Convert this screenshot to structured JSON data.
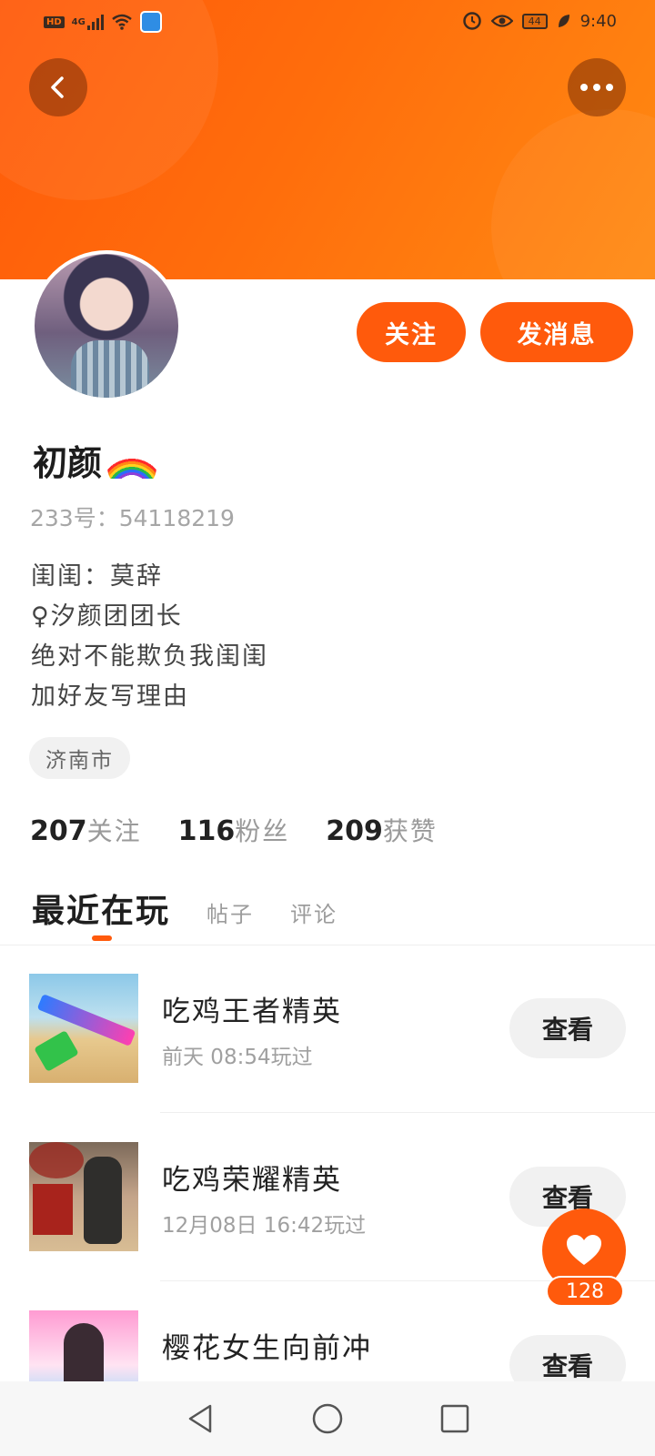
{
  "status_bar": {
    "left_badge": "HD",
    "network": "4G",
    "battery": "44",
    "time": "9:40"
  },
  "header": {
    "back_icon": "chevron-left-icon",
    "more_icon": "more-horizontal-icon",
    "banner_color": "#ff6d0c"
  },
  "profile": {
    "name": "初颜",
    "name_emoji": "rainbow-icon",
    "uid_label": "233号：",
    "uid_value": "54118219",
    "bio_lines": [
      "闺闺：莫辞",
      "♀汐颜团团长",
      "绝对不能欺负我闺闺",
      "加好友写理由"
    ],
    "city": "济南市"
  },
  "actions": {
    "follow_label": "关注",
    "message_label": "发消息",
    "accent_color": "#ff5a0c"
  },
  "stats": [
    {
      "num": "207",
      "label": "关注"
    },
    {
      "num": "116",
      "label": "粉丝"
    },
    {
      "num": "209",
      "label": "获赞"
    }
  ],
  "tabs": {
    "active": "最近在玩",
    "items": [
      "帖子",
      "评论"
    ]
  },
  "games": [
    {
      "name": "吃鸡王者精英",
      "time": "前天 08:54玩过",
      "button": "查看"
    },
    {
      "name": "吃鸡荣耀精英",
      "time": "12月08日 16:42玩过",
      "button": "查看"
    },
    {
      "name": "樱花女生向前冲",
      "time": "",
      "button": "查看"
    }
  ],
  "like_fab": {
    "icon": "heart-icon",
    "count": "128"
  },
  "nav": {
    "back": "triangle-back-icon",
    "home": "circle-home-icon",
    "recents": "square-recents-icon"
  }
}
